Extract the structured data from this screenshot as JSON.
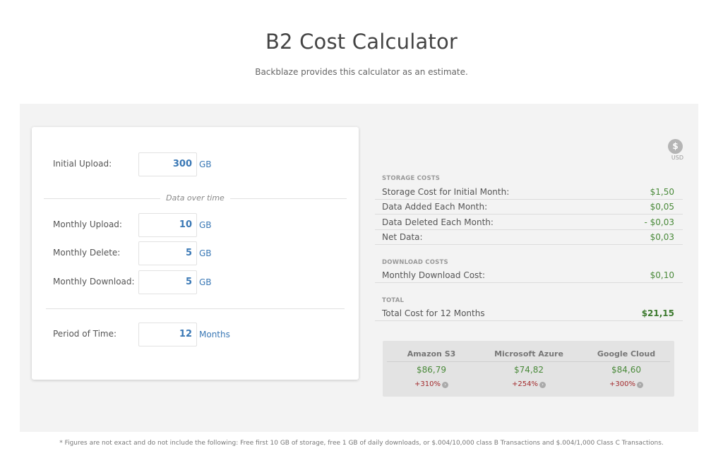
{
  "header": {
    "title": "B2 Cost Calculator",
    "subtitle": "Backblaze provides this calculator as an estimate."
  },
  "inputs": {
    "initial_upload": {
      "label": "Initial Upload:",
      "value": "300",
      "unit": "GB"
    },
    "divider": "Data over time",
    "monthly_upload": {
      "label": "Monthly Upload:",
      "value": "10",
      "unit": "GB"
    },
    "monthly_delete": {
      "label": "Monthly Delete:",
      "value": "5",
      "unit": "GB"
    },
    "monthly_download": {
      "label": "Monthly Download:",
      "value": "5",
      "unit": "GB"
    },
    "period": {
      "label": "Period of Time:",
      "value": "12",
      "unit": "Months"
    }
  },
  "currency": {
    "symbol": "$",
    "code": "USD"
  },
  "storage_costs": {
    "heading": "STORAGE COSTS",
    "rows": [
      {
        "label": "Storage Cost for Initial Month:",
        "value": "$1,50"
      },
      {
        "label": "Data Added Each Month:",
        "value": "$0,05"
      },
      {
        "label": "Data Deleted Each Month:",
        "value": "- $0,03"
      },
      {
        "label": "Net Data:",
        "value": "$0,03"
      }
    ]
  },
  "download_costs": {
    "heading": "DOWNLOAD COSTS",
    "rows": [
      {
        "label": "Monthly Download Cost:",
        "value": "$0,10"
      }
    ]
  },
  "total": {
    "heading": "TOTAL",
    "label": "Total Cost for 12 Months",
    "value": "$21,15"
  },
  "comparison": [
    {
      "name": "Amazon S3",
      "price": "$86,79",
      "pct": "+310%"
    },
    {
      "name": "Microsoft Azure",
      "price": "$74,82",
      "pct": "+254%"
    },
    {
      "name": "Google Cloud",
      "price": "$84,60",
      "pct": "+300%"
    }
  ],
  "footnote": "* Figures are not exact and do not include the following: Free first 10 GB of storage, free 1 GB of daily downloads, or $.004/10,000 class B Transactions and $.004/1,000 Class C Transactions.",
  "colors": {
    "accent_blue": "#3a78b5",
    "cost_green": "#4a8a3a",
    "delta_red": "#a2292b"
  }
}
